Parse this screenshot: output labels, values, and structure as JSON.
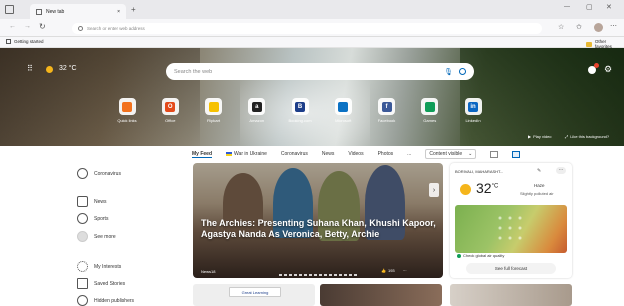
{
  "browser": {
    "tab_title": "New tab",
    "address_placeholder": "Search or enter web address",
    "favorites": {
      "left": "Getting started",
      "right": "Other favorites"
    }
  },
  "hero": {
    "temperature": "32 °C",
    "search_placeholder": "Search the web",
    "tiles": [
      {
        "label": "Quick links",
        "icon": "ql-icon",
        "color": "#f2711c"
      },
      {
        "label": "Office",
        "icon": "office-icon",
        "color": "#e44a1b"
      },
      {
        "label": "Flipkart",
        "icon": "flipkart-icon",
        "color": "#f6c100"
      },
      {
        "label": "Amazon",
        "icon": "amazon-icon",
        "color": "#222"
      },
      {
        "label": "Booking.com",
        "icon": "booking-icon",
        "color": "#1d3e8a"
      },
      {
        "label": "Microsoft",
        "icon": "outlook-icon",
        "color": "#0b72c4"
      },
      {
        "label": "Facebook",
        "icon": "facebook-icon",
        "color": "#3b5998"
      },
      {
        "label": "Games",
        "icon": "games-icon",
        "color": "#0f9d58"
      },
      {
        "label": "LinkedIn",
        "icon": "linkedin-icon",
        "color": "#0a66c2"
      }
    ],
    "video_label": "Play video",
    "image_label": "Like this background?"
  },
  "feed": {
    "tabs": [
      "My Feed",
      "War in Ukraine",
      "Coronavirus",
      "News",
      "Videos",
      "Photos"
    ],
    "more": "...",
    "content": "Content visible"
  },
  "sidebar": [
    {
      "label": "Coronavirus",
      "icon": "globe-icon"
    },
    {
      "label": "News",
      "icon": "news-icon"
    },
    {
      "label": "Sports",
      "icon": "sports-icon"
    },
    {
      "label": "See more",
      "icon": "more-icon"
    },
    {
      "label": "My Interests",
      "icon": "interests-icon"
    },
    {
      "label": "Saved Stories",
      "icon": "bookmark-icon"
    },
    {
      "label": "Hidden publishers",
      "icon": "hidden-icon"
    }
  ],
  "article": {
    "title": "The Archies: Presenting Suhana Khan, Khushi Kapoor, Agastya Nanda As Veronica, Betty, Archie",
    "source": "News18",
    "reactions": "193"
  },
  "weather": {
    "location": "BORIVALI, MAHARASHT...",
    "temp": "32",
    "unit": "°C",
    "condition": "Haze",
    "detail": "Slightly polluted air",
    "air_quality": "Check global air quality",
    "forecast": "See full forecast"
  },
  "bottom": {
    "card2_label": "Great Learning"
  }
}
